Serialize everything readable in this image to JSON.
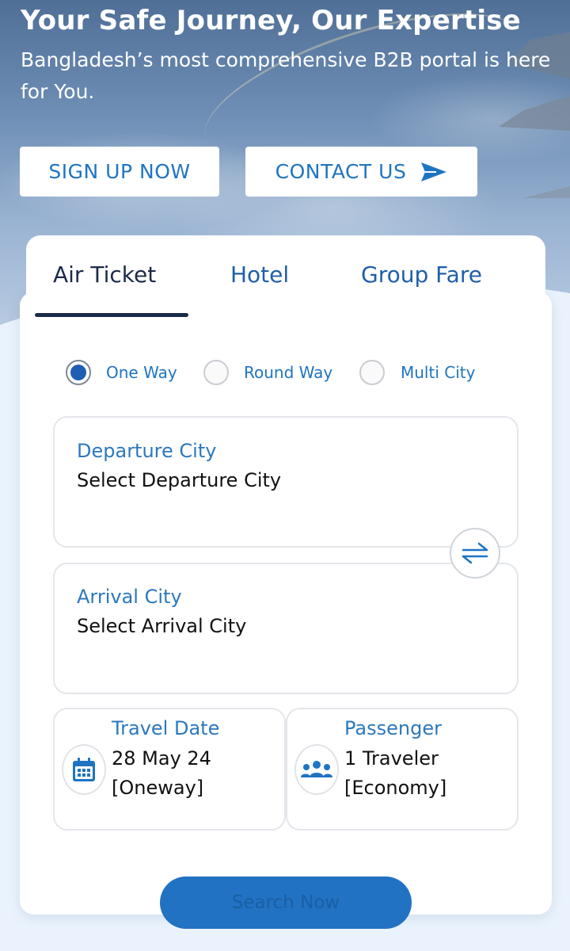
{
  "hero": {
    "headline": "Your Safe Journey, Our Expertise",
    "subline": "Bangladesh’s most comprehensive B2B portal is here for You.",
    "signup_label": "SIGN UP NOW",
    "contact_label": "CONTACT US"
  },
  "tabs": [
    {
      "label": "Air Ticket",
      "active": true
    },
    {
      "label": "Hotel",
      "active": false
    },
    {
      "label": "Group Fare",
      "active": false
    }
  ],
  "trip_types": [
    {
      "label": "One Way",
      "selected": true
    },
    {
      "label": "Round Way",
      "selected": false
    },
    {
      "label": "Multi City",
      "selected": false
    }
  ],
  "departure": {
    "label": "Departure City",
    "value": "Select Departure City"
  },
  "arrival": {
    "label": "Arrival City",
    "value": "Select Arrival City"
  },
  "travel_date": {
    "label": "Travel Date",
    "value": "28 May 24",
    "sub": "[Oneway]"
  },
  "passenger": {
    "label": "Passenger",
    "value": "1 Traveler",
    "sub": "[Economy]"
  },
  "search_label": "Search Now",
  "icons": {
    "send": "send-arrow-icon",
    "swap": "swap-arrows-icon",
    "calendar": "calendar-icon",
    "people": "people-group-icon"
  },
  "colors": {
    "accent": "#1f74c2",
    "tab_active": "#1c2b4a",
    "search_button": "#2272c3"
  }
}
